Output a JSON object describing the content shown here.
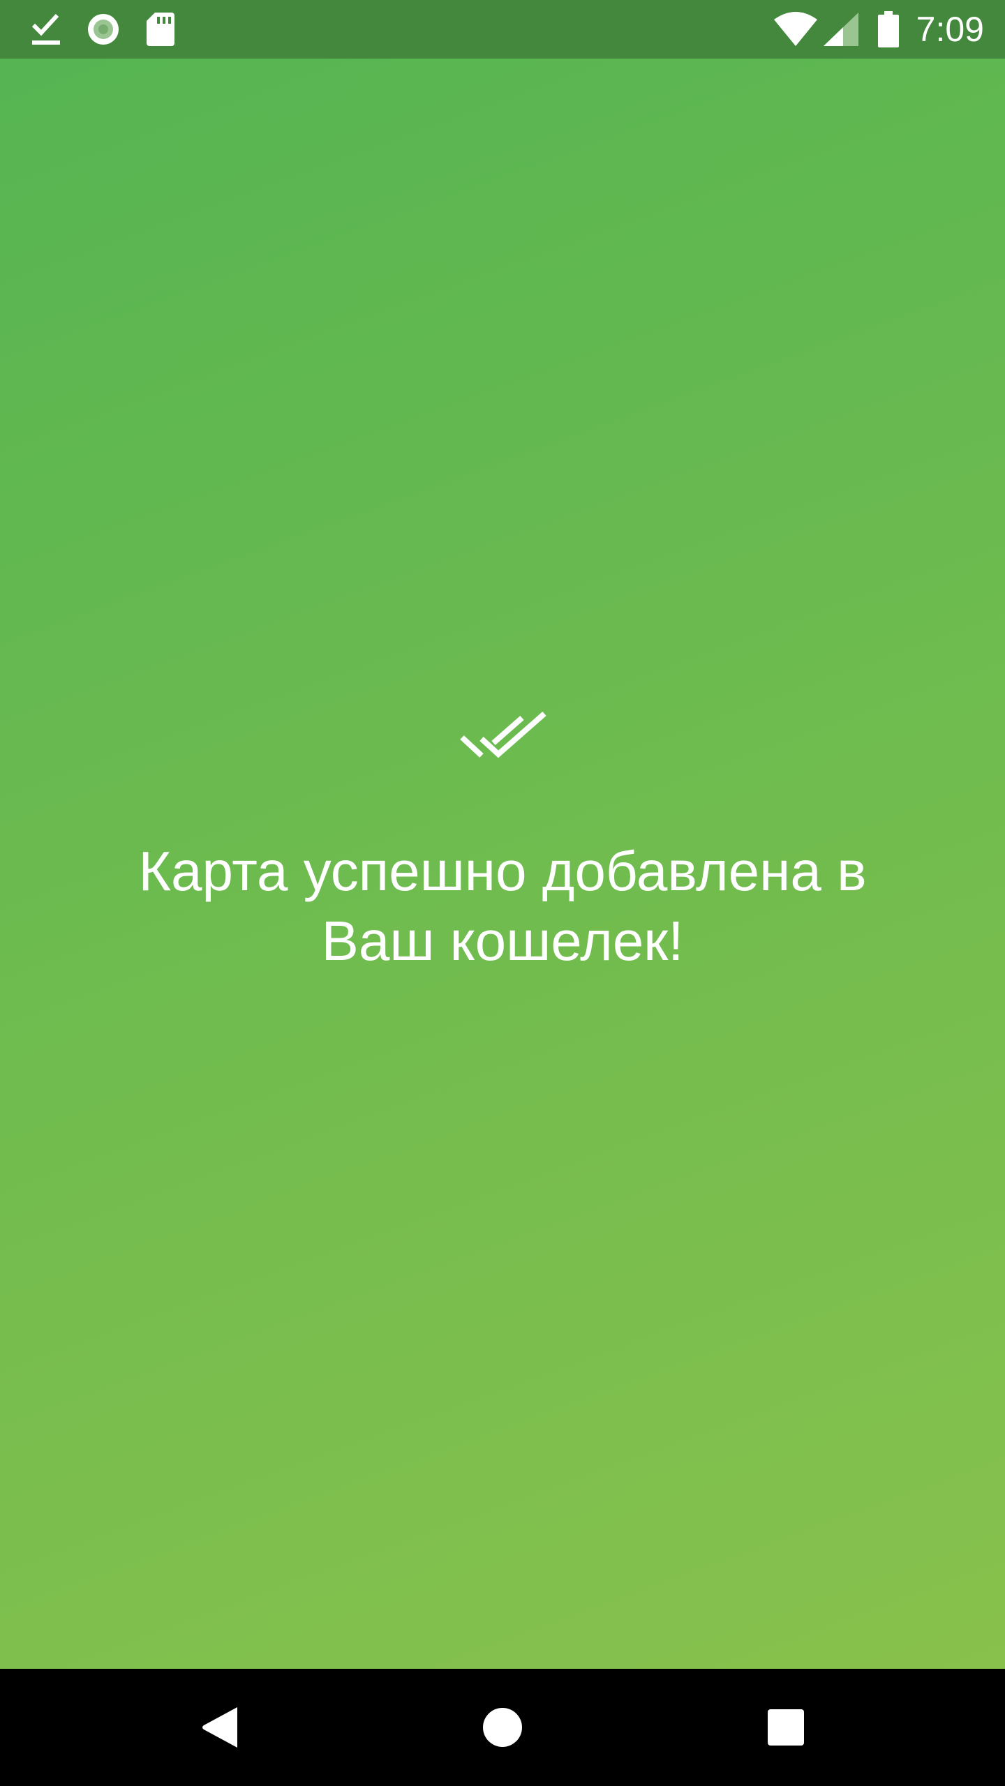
{
  "status_bar": {
    "time": "7:09",
    "icons": {
      "download_done": "download-done-icon",
      "record": "record-icon",
      "sd_card": "sd-card-icon",
      "wifi": "wifi-icon",
      "signal": "cell-signal-icon",
      "battery": "battery-icon"
    }
  },
  "main": {
    "icon": "double-check-icon",
    "message_line1": "Карта успешно добавлена в",
    "message_line2": "Ваш кошелек!"
  },
  "nav_bar": {
    "back": "back-icon",
    "home": "home-icon",
    "recents": "recents-icon"
  },
  "colors": {
    "status_bar": "#43883c",
    "gradient_start": "#54b452",
    "gradient_end": "#8bc24c",
    "nav_bar": "#000000",
    "text": "#ffffff"
  }
}
